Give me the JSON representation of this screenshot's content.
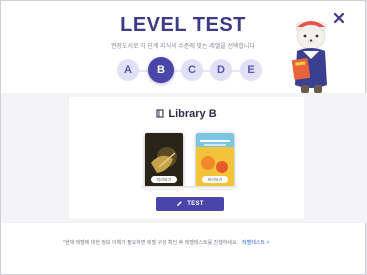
{
  "header": {
    "title": "LEVEL TEST",
    "subtitle": "권장도서로 각 단계 지식의 수준에 맞는 레벨을 선택합니다"
  },
  "steps": [
    {
      "label": "A",
      "active": false
    },
    {
      "label": "B",
      "active": true
    },
    {
      "label": "C",
      "active": false
    },
    {
      "label": "D",
      "active": false
    },
    {
      "label": "E",
      "active": false
    }
  ],
  "library": {
    "title": "Library B",
    "books": [
      {
        "badge": "미리보기"
      },
      {
        "badge": "미리보기"
      }
    ]
  },
  "actions": {
    "test_label": "TEST"
  },
  "footer": {
    "note": "*현재 레벨에 대한 정보 이해가 필요하면 레벨 구성 확인 후 레벨테스트를 진행하세요.",
    "link": "레벨테스트 >"
  },
  "colors": {
    "accent": "#4a45a8",
    "title": "#3d3a86",
    "step_inactive": "#e1e0f4"
  },
  "icons": {
    "close": "close-icon",
    "book": "book-icon",
    "pencil": "pencil-icon"
  }
}
